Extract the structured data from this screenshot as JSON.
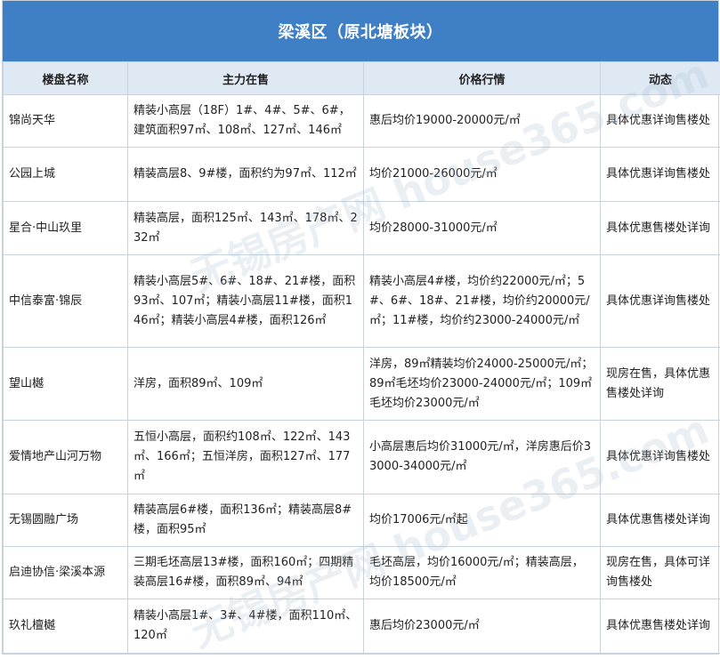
{
  "title": "梁溪区（原北塘板块）",
  "headers": [
    "楼盘名称",
    "主力在售",
    "价格行情",
    "动态"
  ],
  "rows": [
    {
      "name": "锦尚天华",
      "sale": "精装小高层（18F）1#、4#、5#、6#，建筑面积97㎡、108㎡、127㎡、146㎡",
      "price": "惠后均价19000-20000元/㎡",
      "status": "具体优惠详询售楼处"
    },
    {
      "name": "公园上城",
      "sale": "精装高层8、9#楼，面积约为97㎡、112㎡",
      "price": "均价21000-26000元/㎡",
      "status": "具体优惠详询售楼处"
    },
    {
      "name": "星合·中山玖里",
      "sale": "精装高层，面积125㎡、143㎡、178㎡、232㎡",
      "price": "均价28000-31000元/㎡",
      "status": "具体优惠售楼处详询"
    },
    {
      "name": "中信泰富·锦辰",
      "sale": "精装小高层5#、6#、18#、21#楼，面积93㎡、107㎡；精装小高层11#楼，面积146㎡；精装小高层4#楼，面积126㎡",
      "price": "精装小高层4#楼，均价约22000元/㎡；5#、6#、18#、21#楼，均价约20000元/㎡；11#楼，均价约23000-24000元/㎡",
      "status": "具体优惠详询售楼处"
    },
    {
      "name": "望山樾",
      "sale": "洋房，面积89㎡、109㎡",
      "price": "洋房，89㎡精装均价24000-25000元/㎡；89㎡毛坯均价23000-24000元/㎡；109㎡毛坯均价23000元/㎡",
      "status": "现房在售，具体优惠售楼处详询"
    },
    {
      "name": "爱情地产山河万物",
      "sale": "五恒小高层，面积约108㎡、122㎡、143㎡、166㎡；五恒洋房，面积127㎡、177㎡",
      "price": "小高层惠后均价31000元/㎡，洋房惠后价33000-34000元/㎡",
      "status": "具体优惠详询售楼处"
    },
    {
      "name": "无锡圆融广场",
      "sale": "精装高层6#楼，面积136㎡；精装高层8#楼，面积95㎡",
      "price": "均价17006元/㎡起",
      "status": "具体优惠售楼处详询"
    },
    {
      "name": "启迪协信·梁溪本源",
      "sale": "三期毛坯高层13#楼，面积160㎡；四期精装高层16#楼，面积89㎡、94㎡",
      "price": "毛坯高层，均价16000元/㎡；精装高层，均价18500元/㎡",
      "status": "现房在售，具体可详询售楼处"
    },
    {
      "name": " 玖礼檀樾",
      "sale": "精装小高层1#、3#、4#楼，面积110㎡、120㎡",
      "price": "惠后均价23000元/㎡",
      "status": "具体优惠售楼处详询"
    }
  ],
  "watermark": "无锡房产网 house365.com"
}
